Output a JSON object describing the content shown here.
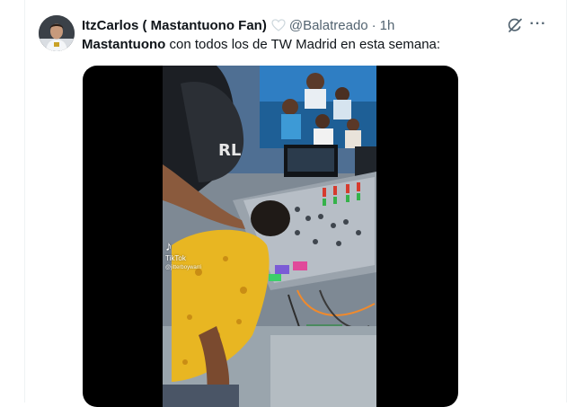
{
  "tweet": {
    "author_name": "ItzCarlos ( Mastantuono Fan)",
    "handle": "@Balatreado",
    "separator": "·",
    "time": "1h",
    "text_bold": "Mastantuono",
    "text_rest": " con todos los de TW Madrid en esta semana:",
    "more_label": "···"
  },
  "media": {
    "watermark_brand": "TikTok",
    "watermark_user": "@jitterboywarri",
    "watermark_glyph": "♪"
  },
  "icons": {
    "heart": "heart-icon",
    "grok": "grok-icon",
    "more": "more-icon"
  },
  "colors": {
    "secondary_text": "#536471",
    "border": "#eff3f4",
    "media_background": "#000000"
  }
}
